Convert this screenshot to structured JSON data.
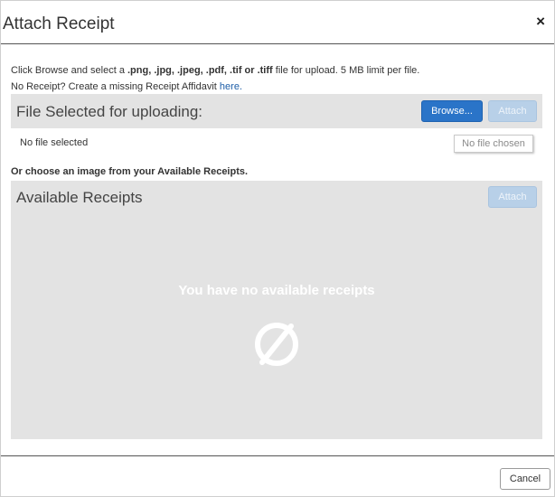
{
  "dialog": {
    "title": "Attach Receipt",
    "close_label": "×"
  },
  "intro": {
    "line1_prefix": "Click Browse and select a ",
    "line1_formats": ".png, .jpg, .jpeg, .pdf, .tif or .tiff",
    "line1_suffix": " file for upload. 5 MB limit per file.",
    "line2_prefix": "No Receipt? Create a missing Receipt Affidavit ",
    "line2_link": "here."
  },
  "upload": {
    "title": "File Selected for uploading:",
    "browse_label": "Browse...",
    "attach_label": "Attach",
    "no_file_text": "No file selected",
    "file_input_text": "No file chosen"
  },
  "or_choose_text": "Or choose an image from your Available Receipts.",
  "available": {
    "title": "Available Receipts",
    "attach_label": "Attach",
    "empty_message": "You have no available receipts",
    "empty_icon": "no-symbol-icon"
  },
  "footer": {
    "cancel_label": "Cancel"
  },
  "colors": {
    "primary_button": "#2a74c8",
    "disabled_button": "#b8d0e8",
    "panel_bg": "#e3e3e3",
    "link": "#1f5fa8"
  }
}
